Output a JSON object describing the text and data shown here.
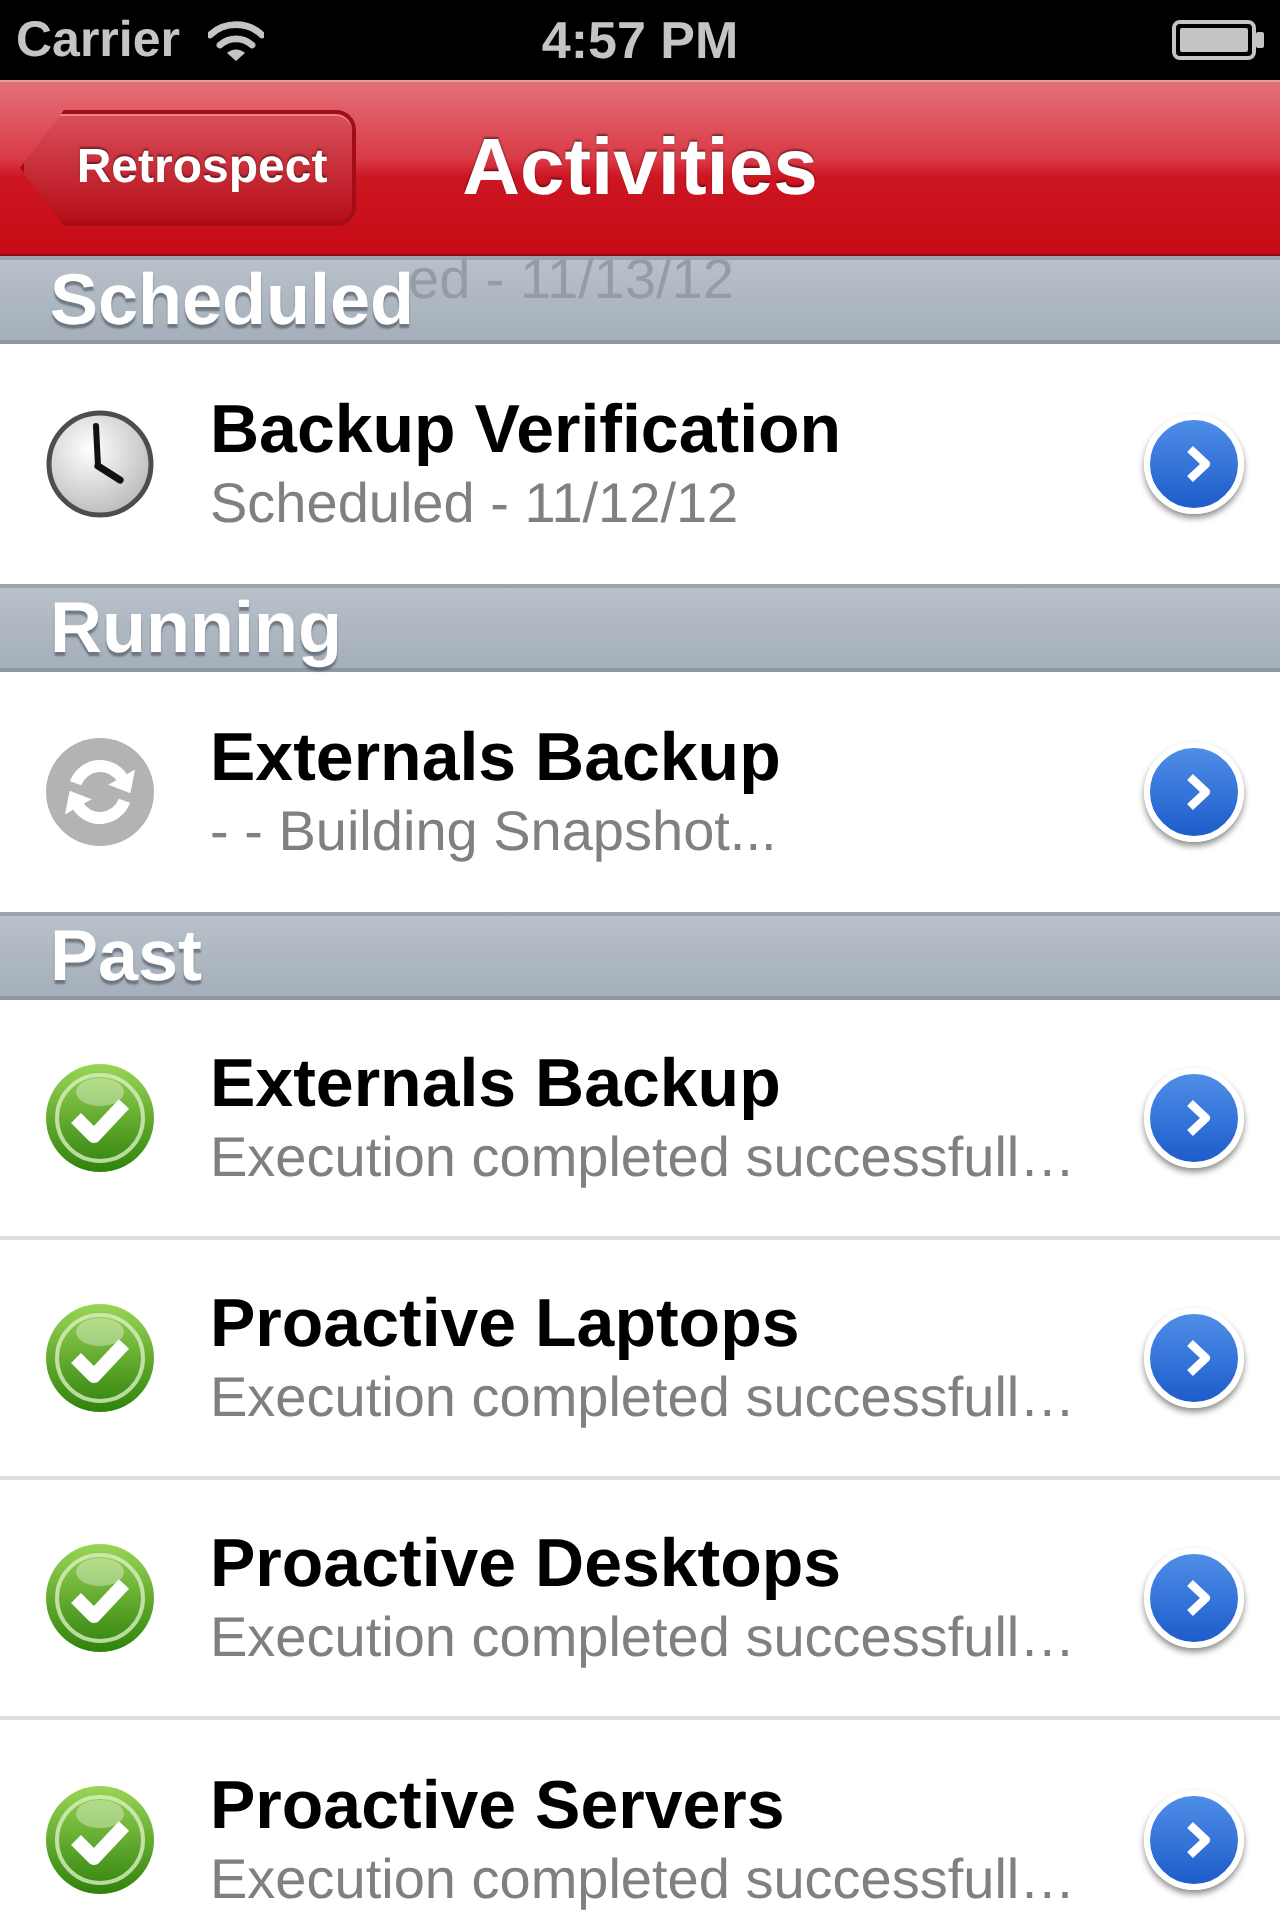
{
  "status_bar": {
    "carrier": "Carrier",
    "time": "4:57 PM"
  },
  "nav_bar": {
    "back_button": "Retrospect",
    "title": "Activities"
  },
  "sections": [
    {
      "title": "Scheduled",
      "row_under_header": {
        "subtitle": "ed - 11/13/12"
      },
      "rows": [
        {
          "kind": "scheduled",
          "title": "Backup Verification",
          "subtitle": "Scheduled - 11/12/12"
        }
      ]
    },
    {
      "title": "Running",
      "rows": [
        {
          "kind": "running",
          "title": "Externals Backup",
          "subtitle": "- - Building Snapshot..."
        }
      ]
    },
    {
      "title": "Past",
      "rows": [
        {
          "kind": "completed",
          "title": "Externals Backup",
          "subtitle": "Execution completed successfull…"
        },
        {
          "kind": "completed",
          "title": "Proactive Laptops",
          "subtitle": "Execution completed successfull…"
        },
        {
          "kind": "completed",
          "title": "Proactive Desktops",
          "subtitle": "Execution completed successfull…"
        },
        {
          "kind": "completed",
          "title": "Proactive Servers",
          "subtitle": "Execution completed successfull…"
        }
      ]
    }
  ]
}
